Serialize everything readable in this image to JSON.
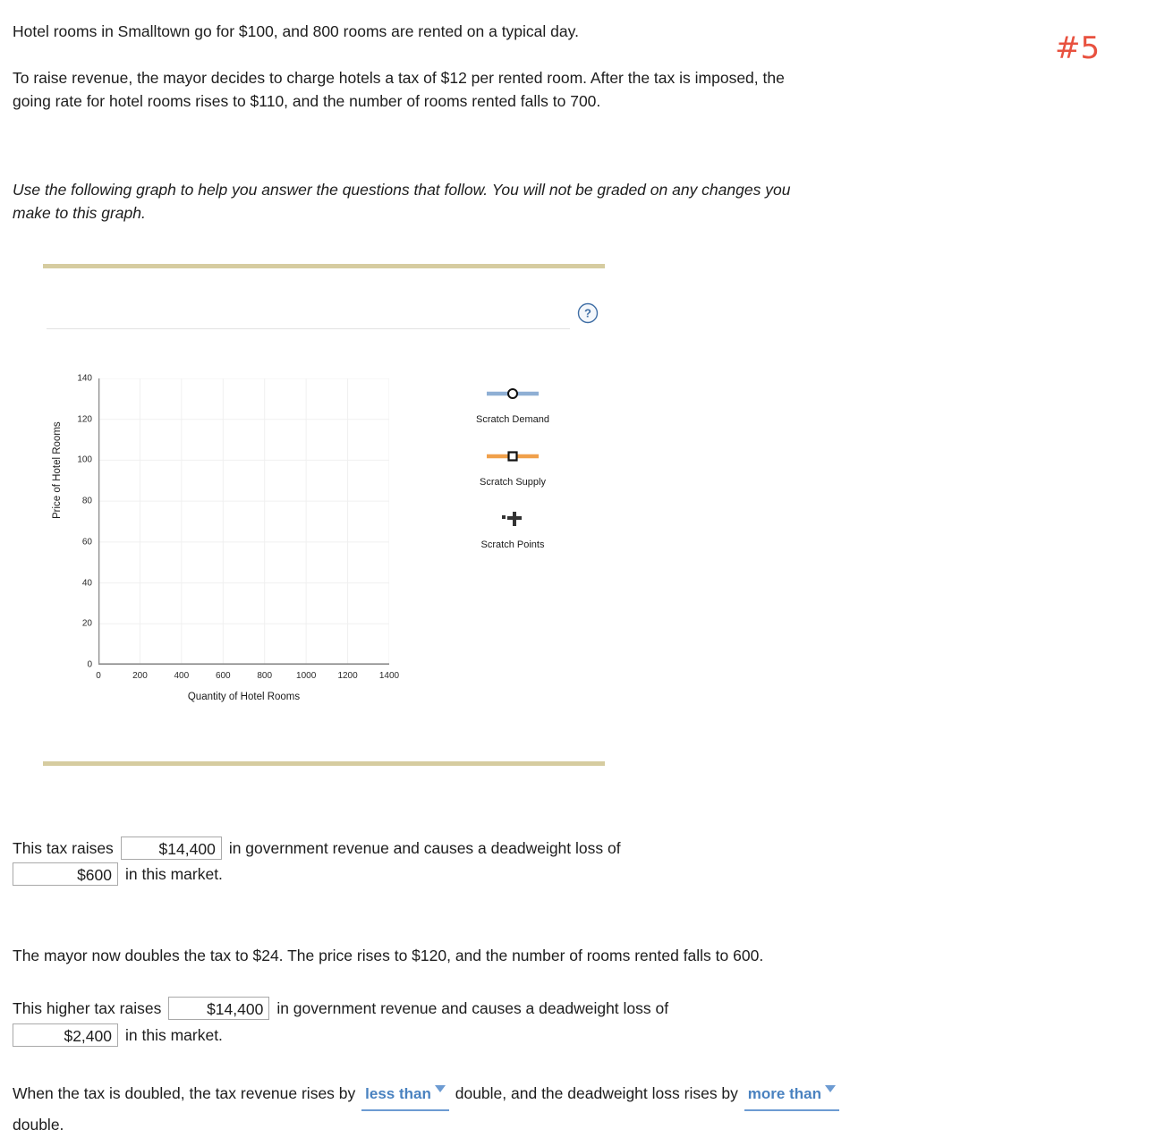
{
  "annotation": {
    "mark": "#5"
  },
  "problem": {
    "paragraph1": "Hotel rooms in Smalltown go for $100, and 800 rooms are rented on a typical day.",
    "paragraph2": "To raise revenue, the mayor decides to charge hotels a tax of $12 per rented room. After the tax is imposed, the going rate for hotel rooms rises to $110, and the number of rooms rented falls to 700.",
    "instruction": "Use the following graph to help you answer the questions that follow. You will not be graded on any changes you make to this graph.",
    "paragraph3": "The mayor now doubles the tax to $24. The price rises to $120, and the number of rooms rented falls to 600."
  },
  "graph_widget": {
    "help_icon": "question-mark-icon",
    "accent_color": "#d6cca0"
  },
  "chart_data": {
    "type": "line",
    "title": "",
    "xlabel": "Quantity of Hotel Rooms",
    "ylabel": "Price of Hotel Rooms",
    "xlim": [
      0,
      1400
    ],
    "ylim": [
      0,
      140
    ],
    "xticks": [
      0,
      200,
      400,
      600,
      800,
      1000,
      1200,
      1400
    ],
    "yticks": [
      0,
      20,
      40,
      60,
      80,
      100,
      120,
      140
    ],
    "grid": true,
    "legend_position": "right",
    "series": [
      {
        "name": "Scratch Demand",
        "color": "#8fafd4",
        "marker": "circle",
        "x": [],
        "values": []
      },
      {
        "name": "Scratch Supply",
        "color": "#f0a04b",
        "marker": "square",
        "x": [],
        "values": []
      },
      {
        "name": "Scratch Points",
        "color": "#333333",
        "marker": "cross",
        "x": [],
        "values": []
      }
    ]
  },
  "answers": {
    "line1_pre": "This tax raises",
    "line1_value": "$14,400",
    "line1_mid": "in government revenue and causes a deadweight loss of",
    "line1b_value": "$600",
    "line1b_post": "in this market.",
    "line2_pre": "This higher tax raises",
    "line2_value": "$14,400",
    "line2_mid": "in government revenue and causes a deadweight loss of",
    "line2b_value": "$2,400",
    "line2b_post": "in this market.",
    "line3_pre": "When the tax is doubled, the tax revenue rises by",
    "dropdown1": "less than",
    "line3_mid": "double, and the deadweight loss rises by",
    "dropdown2": "more than",
    "line3_post": "double."
  }
}
